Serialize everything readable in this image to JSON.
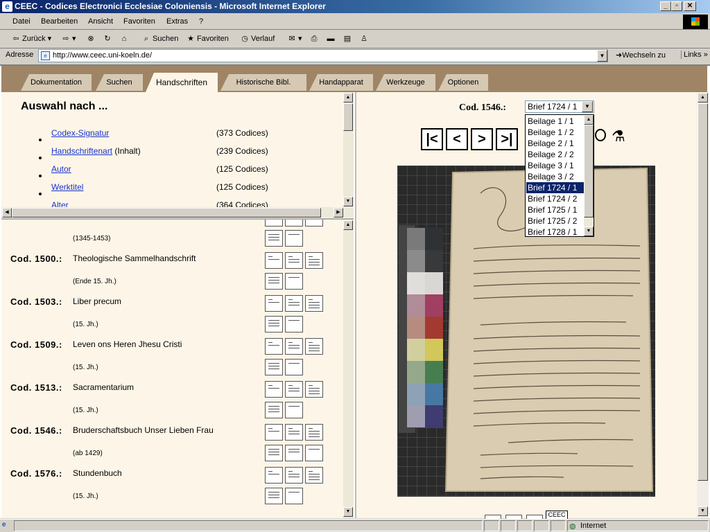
{
  "window": {
    "title": "CEEC - Codices Electronici Ecclesiae Coloniensis - Microsoft Internet Explorer"
  },
  "menu": [
    "Datei",
    "Bearbeiten",
    "Ansicht",
    "Favoriten",
    "Extras",
    "?"
  ],
  "toolbar": {
    "back": "Zurück",
    "search": "Suchen",
    "favorites": "Favoriten",
    "history": "Verlauf"
  },
  "address": {
    "label": "Adresse",
    "url": "http://www.ceec.uni-koeln.de/",
    "go": "Wechseln zu",
    "links": "Links"
  },
  "tabs": [
    "Dokumentation",
    "Suchen",
    "Handschriften",
    "Historische Bibl.",
    "Handapparat",
    "Werkzeuge",
    "Optionen"
  ],
  "active_tab": "Handschriften",
  "selection": {
    "heading": "Auswahl nach ...",
    "items": [
      {
        "link": "Codex-Signatur",
        "extra": "",
        "count": "(373 Codices)"
      },
      {
        "link": "Handschriftenart",
        "extra": " (Inhalt)",
        "count": "(239 Codices)"
      },
      {
        "link": "Autor",
        "extra": "",
        "count": "(125 Codices)"
      },
      {
        "link": "Werktitel",
        "extra": "",
        "count": "(125 Codices)"
      },
      {
        "link": "Alter",
        "extra": "",
        "count": "(364 Codices)"
      }
    ]
  },
  "codices": {
    "first_date": "(1345-1453)",
    "list": [
      {
        "num": "Cod. 1500.:",
        "title": "Theologische Sammelhandschrift",
        "date": "(Ende 15. Jh.)"
      },
      {
        "num": "Cod. 1503.:",
        "title": "Liber precum",
        "date": "(15. Jh.)"
      },
      {
        "num": "Cod. 1509.:",
        "title": "Leven ons Heren Jhesu Cristi",
        "date": "(15. Jh.)"
      },
      {
        "num": "Cod. 1513.:",
        "title": "Sacramentarium",
        "date": "(15. Jh.)"
      },
      {
        "num": "Cod. 1546.:",
        "title": "Bruderschaftsbuch Unser Lieben Frau",
        "date": "(ab 1429)"
      },
      {
        "num": "Cod. 1576.:",
        "title": "Stundenbuch",
        "date": "(15. Jh.)"
      }
    ]
  },
  "viewer": {
    "cod_label": "Cod. 1546.:",
    "selected": "Brief 1724 / 1",
    "options": [
      "Beilage 1 / 1",
      "Beilage 1 / 2",
      "Beilage 2 / 1",
      "Beilage 2 / 2",
      "Beilage 3 / 1",
      "Beilage 3 / 2",
      "Brief 1724 / 1",
      "Brief 1724 / 2",
      "Brief 1725 / 1",
      "Brief 1725 / 2",
      "Brief 1728 / 1"
    ],
    "nav": {
      "first": "|<",
      "prev": "<",
      "next": ">",
      "last": ">|"
    },
    "footer_label": "CEEC"
  },
  "status": {
    "zone": "Internet"
  }
}
